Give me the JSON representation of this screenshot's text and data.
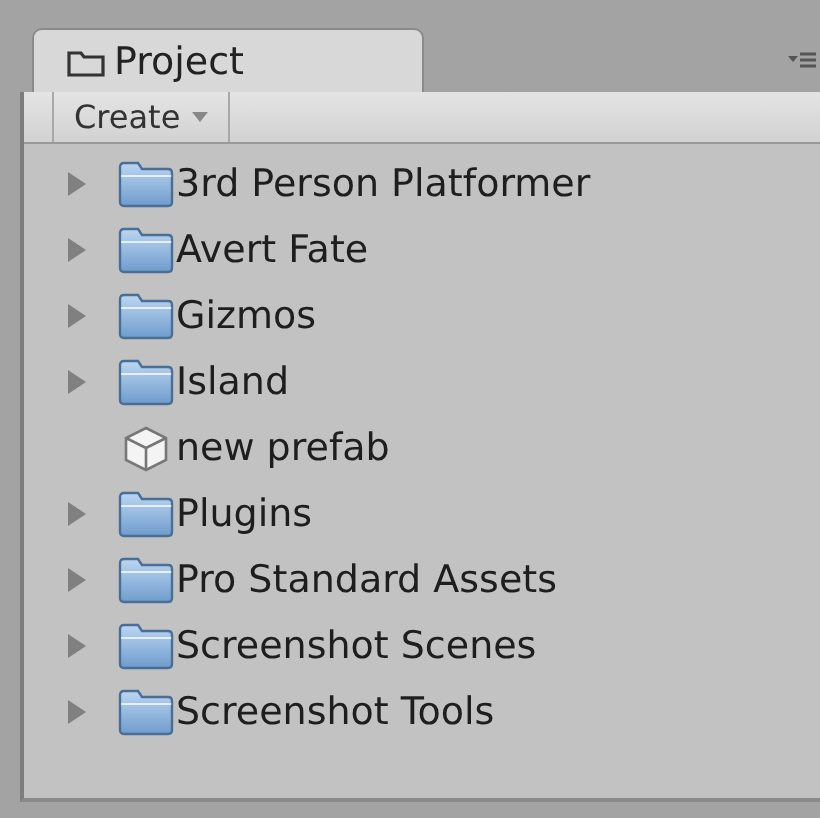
{
  "tab": {
    "title": "Project",
    "selected": true
  },
  "toolbar": {
    "create_button": "Create"
  },
  "tree": [
    {
      "name": "3rd Person Platformer",
      "kind": "folder",
      "expanded": false
    },
    {
      "name": "Avert Fate",
      "kind": "folder",
      "expanded": false
    },
    {
      "name": "Gizmos",
      "kind": "folder",
      "expanded": false
    },
    {
      "name": "Island",
      "kind": "folder",
      "expanded": false
    },
    {
      "name": "new prefab",
      "kind": "prefab"
    },
    {
      "name": "Plugins",
      "kind": "folder",
      "expanded": false
    },
    {
      "name": "Pro Standard Assets",
      "kind": "folder",
      "expanded": false
    },
    {
      "name": "Screenshot Scenes",
      "kind": "folder",
      "expanded": false
    },
    {
      "name": "Screenshot Tools",
      "kind": "folder",
      "expanded": false
    }
  ]
}
